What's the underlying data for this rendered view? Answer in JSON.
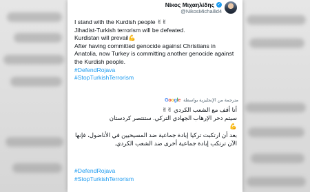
{
  "header": {
    "display_name": "Νίκος Μιχαηλίδης",
    "handle": "@NikosMichailid4"
  },
  "tweet": {
    "lines": [
      "I stand with the Kurdish people ✌✌",
      "Jihadist-Turkish terrorism will be defeated.",
      "Kurdistan will prevail💪",
      "After having committed genocide against Christians in Anatolia, now Turkey is committing another genocide against the Kurdish people."
    ],
    "hashtags": [
      "#DefendRojava",
      "#StopTurkishTerrorism"
    ]
  },
  "translation": {
    "label": "مترجمة من الإنجليزية بواسطة",
    "provider": "Google",
    "lines": [
      "أنا أقف مع الشعب الكردي ✌✌",
      "سيتم دحر الإرهاب الجهادي التركي. ستنتصر كردستان",
      "💪",
      "بعد أن ارتكبت تركيا إبادة جماعية ضد المسيحيين في الأناضول، فإنها الآن ترتكب إبادة جماعية أخرى ضد الشعب الكردي."
    ],
    "hashtags": [
      "#DefendRojava",
      "#StopTurkishTerrorism"
    ]
  },
  "colors": {
    "link": "#1d9bf0",
    "text": "#0f1419",
    "muted": "#536471",
    "verified": "#1d9bf0"
  },
  "icons": [
    "verified-badge-icon",
    "avatar",
    "google-logo-icon"
  ]
}
